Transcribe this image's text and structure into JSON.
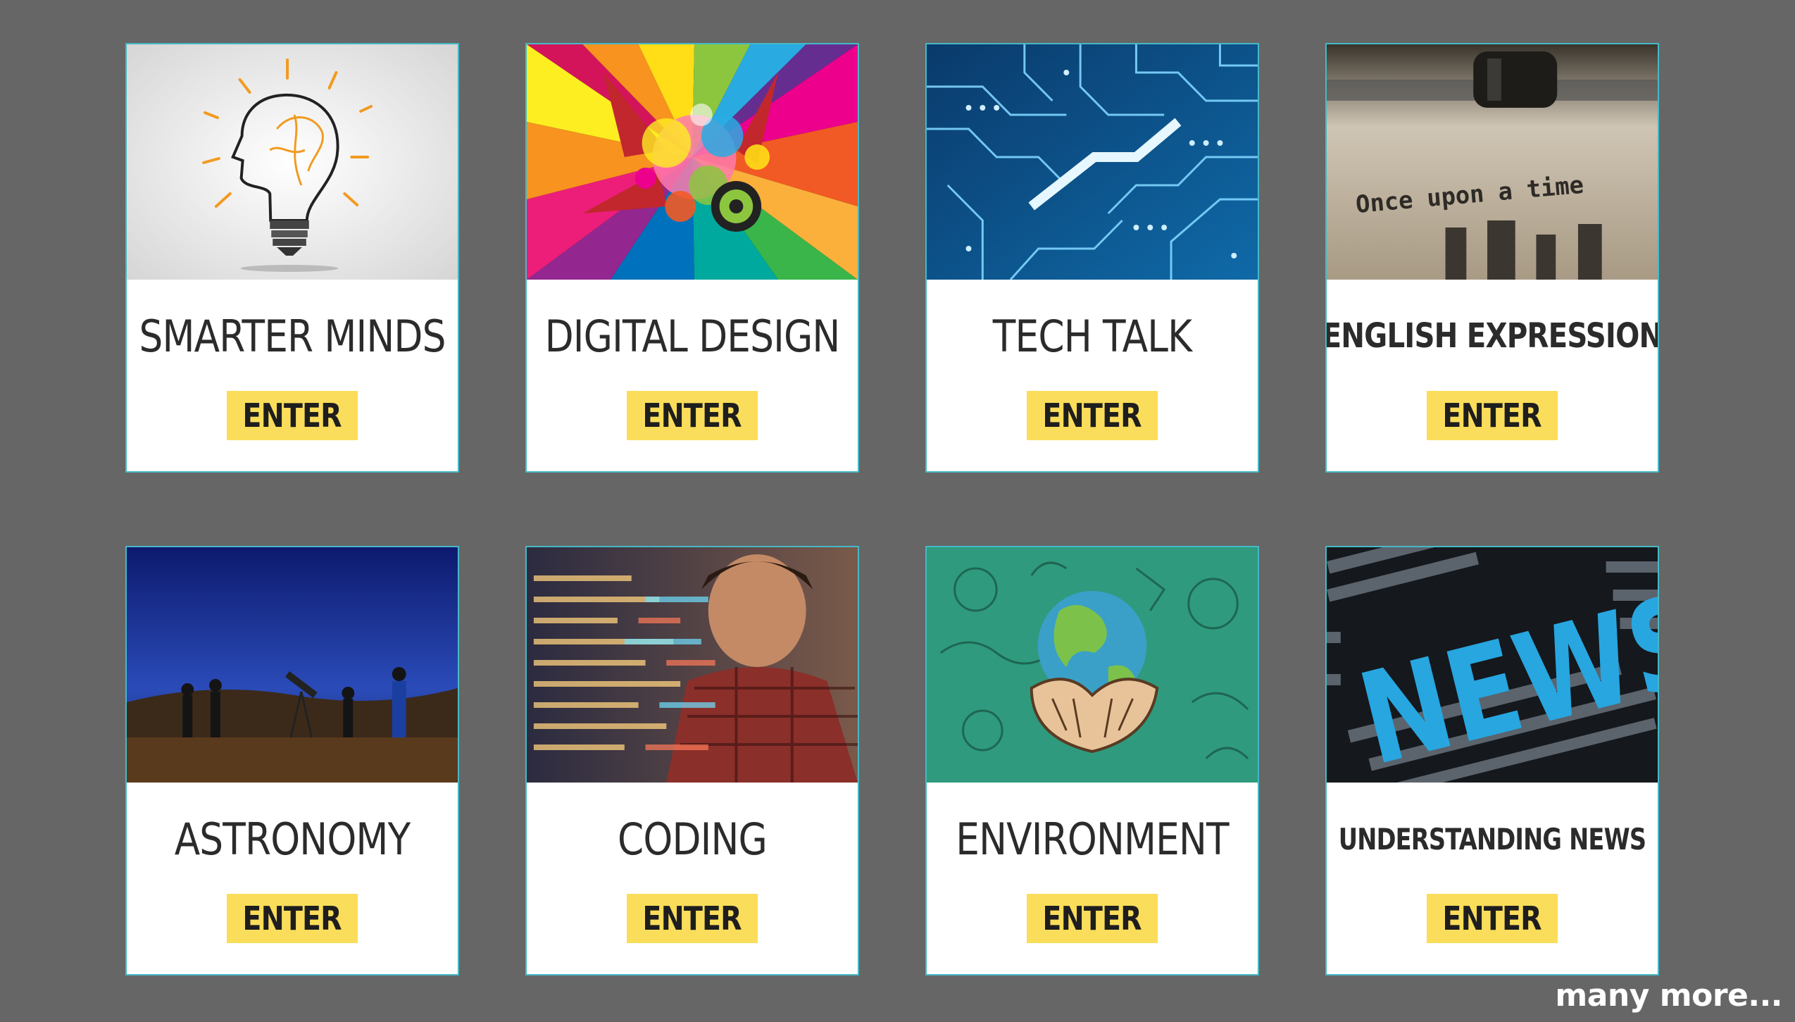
{
  "courses": [
    {
      "title": "SMARTER MINDS",
      "enter_label": "ENTER",
      "image": "lightbulb-head-icon"
    },
    {
      "title": "DIGITAL DESIGN",
      "enter_label": "ENTER",
      "image": "colorful-burst-icon"
    },
    {
      "title": "TECH TALK",
      "enter_label": "ENTER",
      "image": "circuit-board-icon"
    },
    {
      "title": "ENGLISH EXPRESSION",
      "enter_label": "ENTER",
      "image": "typewriter-icon",
      "image_text": "Once upon a time"
    },
    {
      "title": "ASTRONOMY",
      "enter_label": "ENTER",
      "image": "stargazers-telescope-icon"
    },
    {
      "title": "CODING",
      "enter_label": "ENTER",
      "image": "coder-screen-icon"
    },
    {
      "title": "ENVIRONMENT",
      "enter_label": "ENTER",
      "image": "earth-in-hands-icon"
    },
    {
      "title": "UNDERSTANDING NEWS",
      "enter_label": "ENTER",
      "image": "news-words-icon",
      "image_text": "NEWS"
    }
  ],
  "more_link": "many more...",
  "colors": {
    "background": "#666666",
    "card": "#ffffff",
    "card_border": "#46b8c6",
    "enter_button": "#fadd5a",
    "text": "#2b2b2b"
  }
}
